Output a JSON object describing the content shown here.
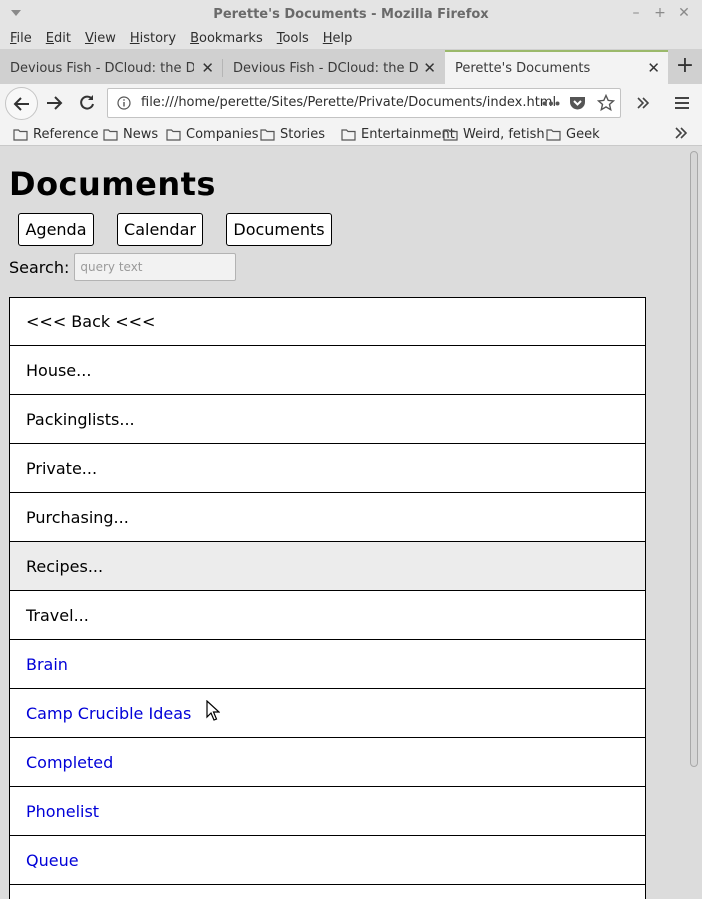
{
  "window": {
    "title": "Perette's Documents - Mozilla Firefox"
  },
  "menubar": {
    "items": [
      {
        "label": "File",
        "key": "F",
        "rest": "ile"
      },
      {
        "label": "Edit",
        "key": "E",
        "rest": "dit"
      },
      {
        "label": "View",
        "key": "V",
        "rest": "iew"
      },
      {
        "label": "History",
        "key": "H",
        "rest": "istory",
        "pre": ""
      },
      {
        "label": "Bookmarks",
        "key": "B",
        "rest": "ookmarks"
      },
      {
        "label": "Tools",
        "key": "T",
        "rest": "ools"
      },
      {
        "label": "Help",
        "key": "H",
        "rest": "elp"
      }
    ]
  },
  "tabs": [
    {
      "label": "Devious Fish - DCloud: the Devio",
      "active": false
    },
    {
      "label": "Devious Fish - DCloud: the Devio",
      "active": false
    },
    {
      "label": "Perette's Documents",
      "active": true
    }
  ],
  "navbar": {
    "url": "file:///home/perette/Sites/Perette/Private/Documents/index.html"
  },
  "bookmarks": [
    "Reference",
    "News",
    "Companies",
    "Stories",
    "Entertainment",
    "Weird, fetish",
    "Geek"
  ],
  "page": {
    "title": "Documents",
    "buttons": [
      "Agenda",
      "Calendar",
      "Documents"
    ],
    "search_label": "Search:",
    "search_placeholder": "query text",
    "rows": [
      {
        "label": "<<< Back <<<",
        "kind": "nav"
      },
      {
        "label": "House...",
        "kind": "folder"
      },
      {
        "label": "Packinglists...",
        "kind": "folder"
      },
      {
        "label": "Private...",
        "kind": "folder"
      },
      {
        "label": "Purchasing...",
        "kind": "folder"
      },
      {
        "label": "Recipes...",
        "kind": "folder",
        "hover": true
      },
      {
        "label": "Travel...",
        "kind": "folder"
      },
      {
        "label": "Brain",
        "kind": "link"
      },
      {
        "label": "Camp Crucible Ideas",
        "kind": "link"
      },
      {
        "label": "Completed",
        "kind": "link"
      },
      {
        "label": "Phonelist",
        "kind": "link"
      },
      {
        "label": "Queue",
        "kind": "link"
      },
      {
        "label": "",
        "kind": "link"
      }
    ]
  },
  "colors": {
    "link": "#0000d8",
    "active_tab_accent": "#9bb96b",
    "chrome_bg": "#f3f3f3",
    "page_bg": "#dcdcdc"
  }
}
